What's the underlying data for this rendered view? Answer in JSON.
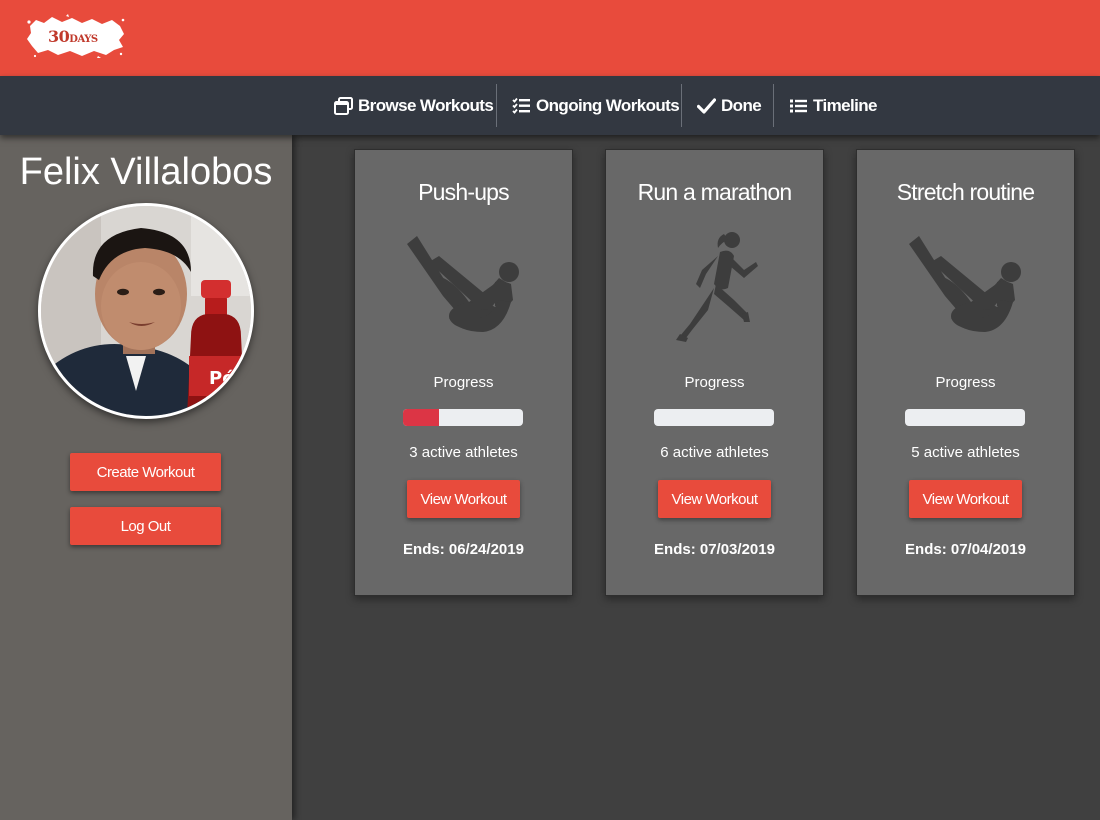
{
  "header": {
    "brand_color": "#e84b3c",
    "logo": {
      "text_number": "30",
      "text_word": "DAYS"
    }
  },
  "nav": {
    "items": [
      {
        "label": "Browse Workouts",
        "icon": "window-restore-icon"
      },
      {
        "label": "Ongoing Workouts",
        "icon": "tasks-icon"
      },
      {
        "label": "Done",
        "icon": "check-icon"
      },
      {
        "label": "Timeline",
        "icon": "list-icon"
      }
    ]
  },
  "sidebar": {
    "user_name": "Felix Villalobos",
    "avatar": "profile-photo",
    "buttons": {
      "create_label": "Create Workout",
      "logout_label": "Log Out"
    }
  },
  "workouts": [
    {
      "title": "Push-ups",
      "figure": "v-up-silhouette-icon",
      "progress_label": "Progress",
      "progress": 0.3,
      "athletes": "3 active athletes",
      "button_label": "View Workout",
      "ends": "Ends: 06/24/2019"
    },
    {
      "title": "Run a marathon",
      "figure": "runner-silhouette-icon",
      "progress_label": "Progress",
      "progress": 0,
      "athletes": "6 active athletes",
      "button_label": "View Workout",
      "ends": "Ends: 07/03/2019"
    },
    {
      "title": "Stretch routine",
      "figure": "v-up-silhouette-icon",
      "progress_label": "Progress",
      "progress": 0,
      "athletes": "5 active athletes",
      "button_label": "View Workout",
      "ends": "Ends: 07/04/2019"
    }
  ],
  "colors": {
    "accent": "#e84b3c",
    "navbar": "#333841",
    "sidebar": "#66635f",
    "content": "#404040",
    "card": "#686868",
    "progress_fill": "#dc3545",
    "progress_track": "#eceef1"
  }
}
